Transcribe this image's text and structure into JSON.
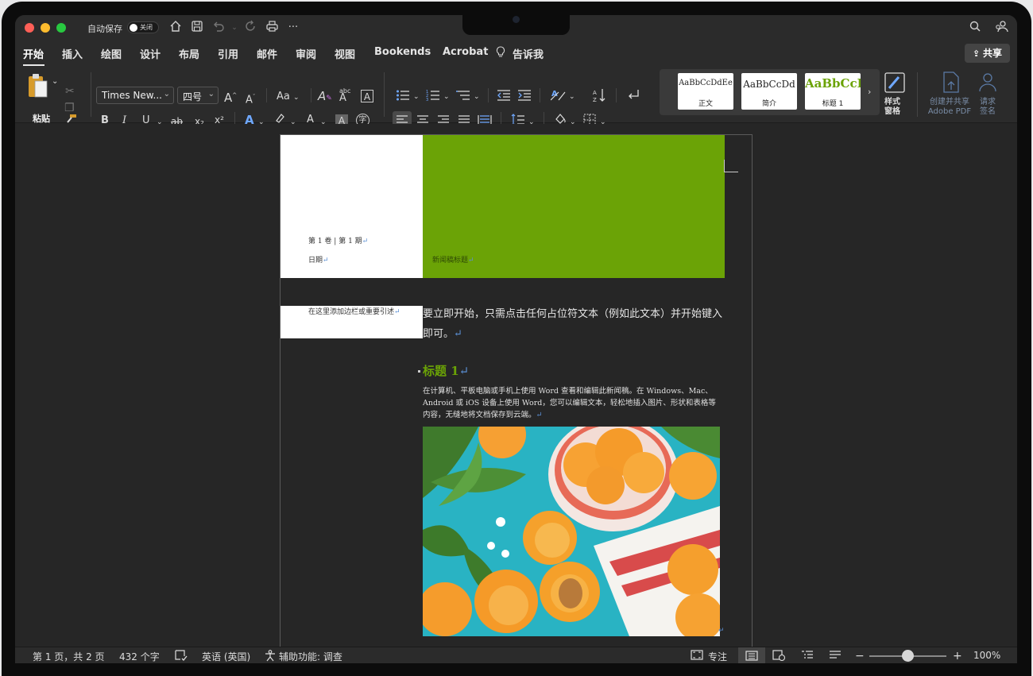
{
  "titlebar": {
    "autosave_label": "自动保存",
    "autosave_state": "关闭",
    "icons": [
      "home-icon",
      "save-icon",
      "undo-icon",
      "redo-icon",
      "print-icon",
      "more-icon",
      "search-icon",
      "share-people-icon"
    ]
  },
  "tabs": [
    {
      "label": "开始",
      "active": true
    },
    {
      "label": "插入"
    },
    {
      "label": "绘图"
    },
    {
      "label": "设计"
    },
    {
      "label": "布局"
    },
    {
      "label": "引用"
    },
    {
      "label": "邮件"
    },
    {
      "label": "审阅"
    },
    {
      "label": "视图"
    },
    {
      "label": "Bookends"
    },
    {
      "label": "Acrobat"
    },
    {
      "label": "告诉我"
    }
  ],
  "share_label": "共享",
  "ribbon": {
    "paste_label": "粘贴",
    "font_name": "Times New...",
    "font_size": "四号",
    "change_case": "Aa",
    "bold": "B",
    "italic": "I",
    "underline": "U",
    "strike": "ab",
    "subscript": "x₂",
    "superscript": "x²",
    "styles": [
      {
        "sample": "AaBbCcDdEe",
        "name": "正文"
      },
      {
        "sample": "AaBbCcDd",
        "name": "简介"
      },
      {
        "sample": "AaBbCcI",
        "name": "标题 1"
      }
    ],
    "styles_pane": "样式\n窗格",
    "create_pdf": "创建并共享\nAdobe PDF",
    "request_sign": "请求\n签名"
  },
  "document": {
    "volume": "第 1 卷 | 第 1 期",
    "date": "日期",
    "newsletter_title": "新闻稿标题",
    "sidebar_quote": "在这里添加边栏或重要引述",
    "intro": "要立即开始，只需点击任何占位符文本（例如此文本）并开始键入即可。",
    "heading1": "标题 1",
    "body": "在计算机、平板电脑或手机上使用 Word 查看和编辑此新闻稿。在 Windows、Mac、Android 或 iOS 设备上使用 Word，您可以编辑文本，轻松地插入图片、形状和表格等内容，无缝地将文档保存到云端。",
    "paragraph_mark": "↵"
  },
  "statusbar": {
    "page_info": "第 1 页，共 2 页",
    "word_count": "432 个字",
    "language": "英语 (英国)",
    "accessibility": "辅助功能: 调查",
    "focus": "专注",
    "zoom_percent": "100%",
    "zoom_fraction": 0.5
  },
  "colors": {
    "accent_green": "#6ba306",
    "ribbon_bg": "#2b2b2b",
    "canvas_bg": "#262626"
  }
}
